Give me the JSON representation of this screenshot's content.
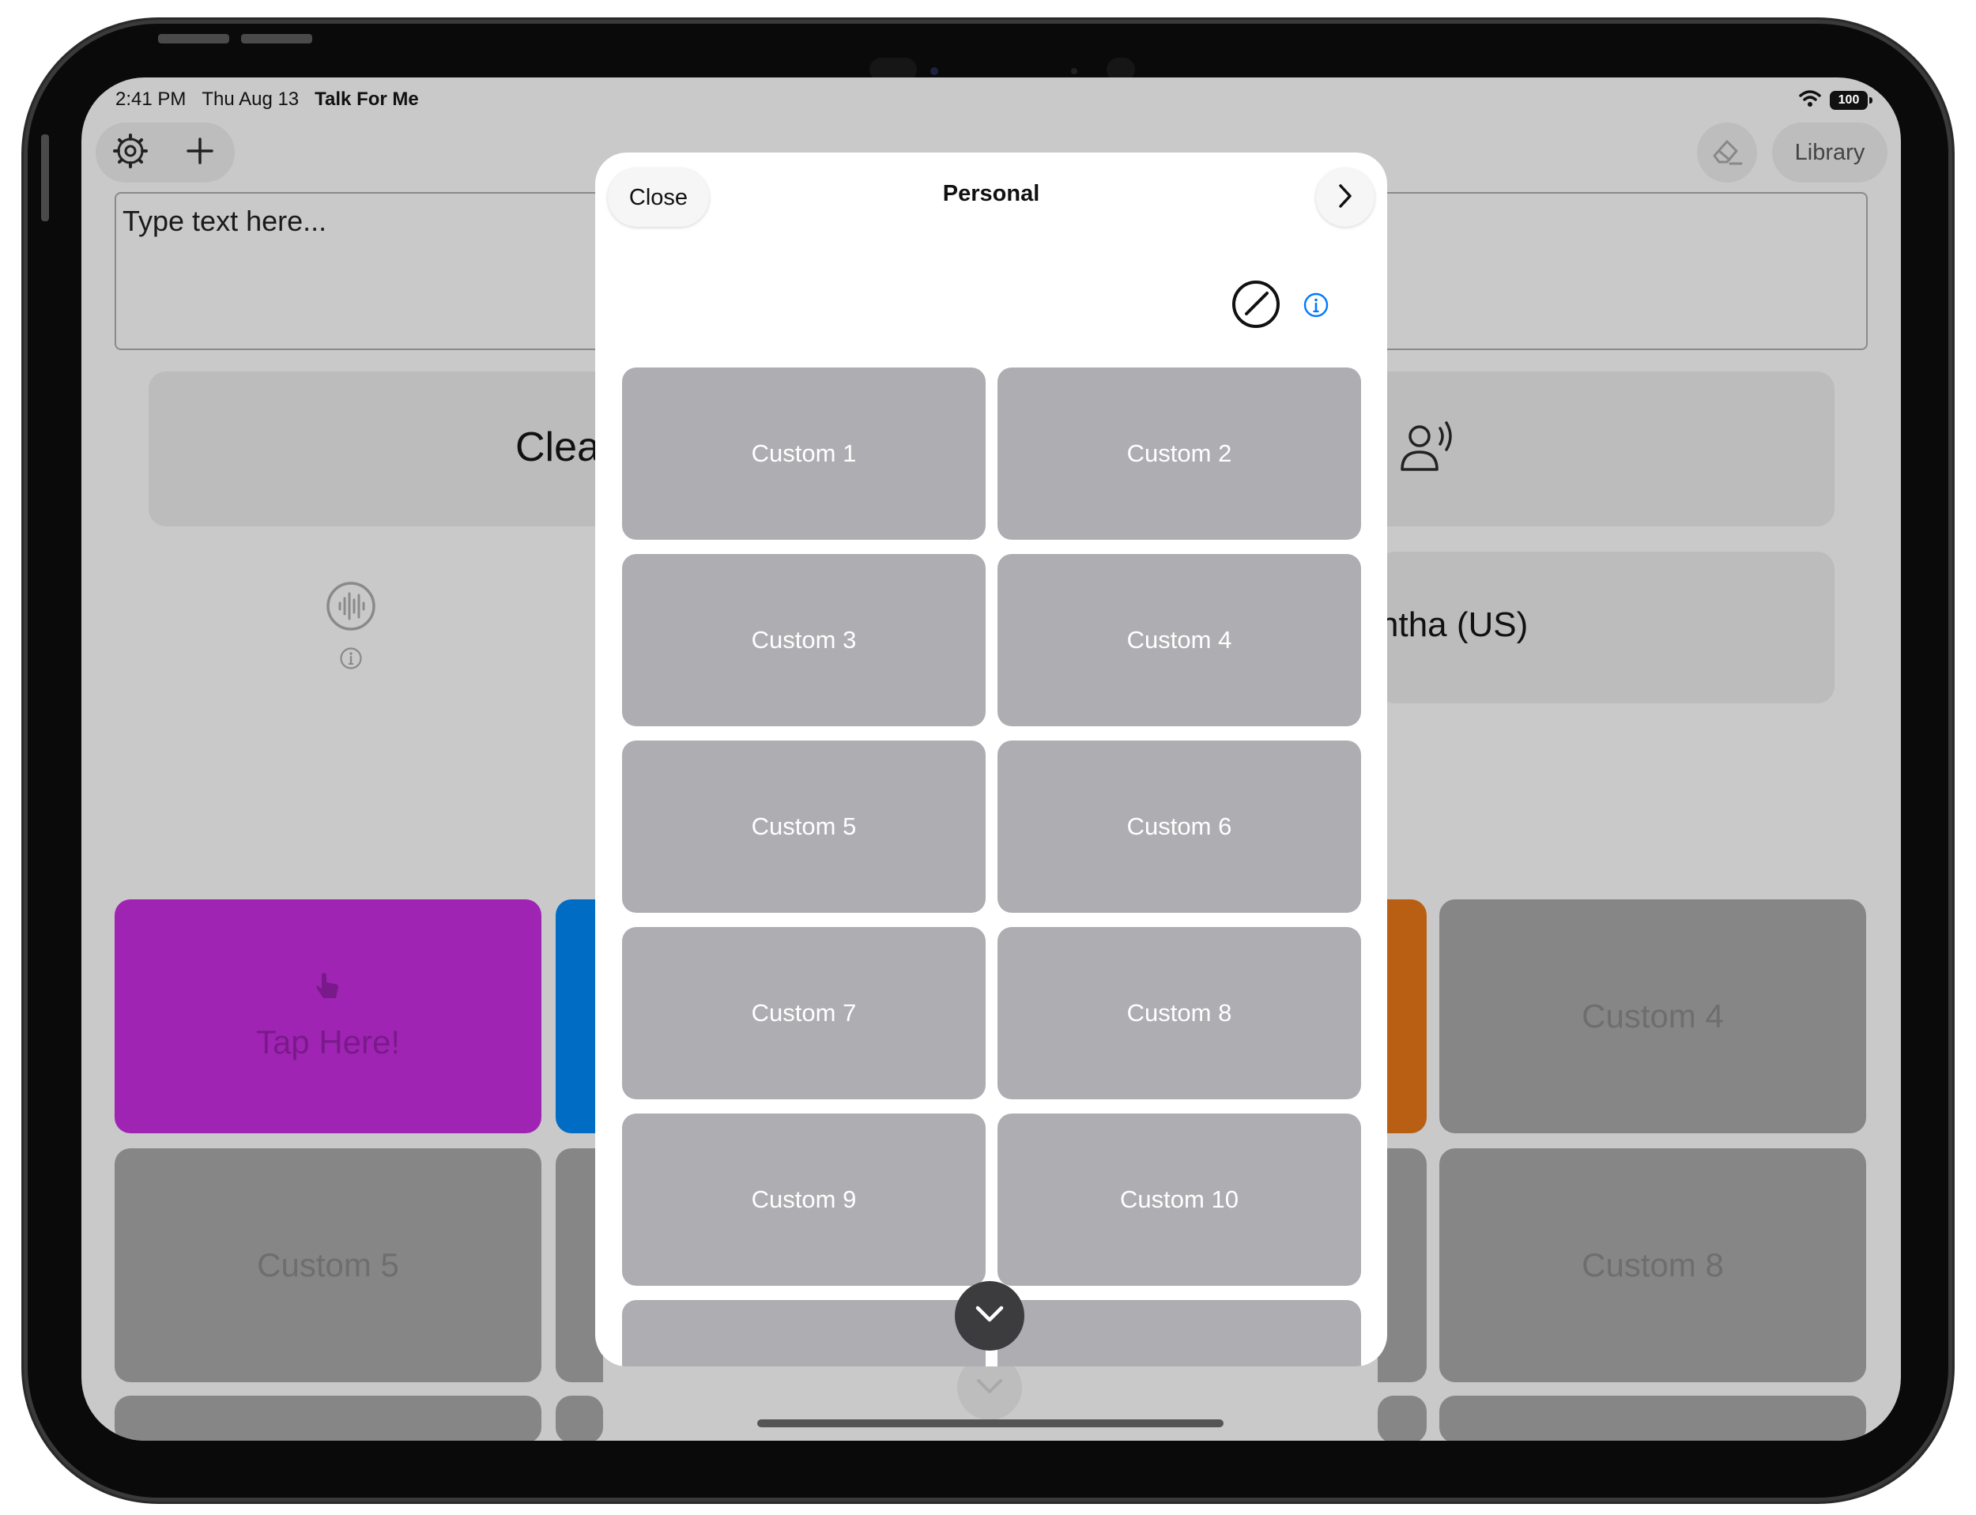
{
  "status_bar": {
    "time": "2:41 PM",
    "date": "Thu Aug 13",
    "app_name": "Talk For Me",
    "battery": "100"
  },
  "toolbar": {
    "library_label": "Library"
  },
  "text_input": {
    "placeholder": "Type text here..."
  },
  "background": {
    "clear_label": "Clea",
    "voice_label": "ntha (US)",
    "tiles": [
      {
        "label": "Tap Here!",
        "color": "#a024b4"
      },
      {
        "label": "",
        "color": "#006cc4"
      },
      {
        "label": "",
        "color": "#b95f14"
      },
      {
        "label": "Custom 4",
        "color": "#868686"
      },
      {
        "label": "Custom 5",
        "color": "#868686"
      },
      {
        "label": "Custom 8",
        "color": "#868686"
      }
    ]
  },
  "modal": {
    "close_label": "Close",
    "title": "Personal",
    "tiles": [
      "Custom 1",
      "Custom 2",
      "Custom 3",
      "Custom 4",
      "Custom 5",
      "Custom 6",
      "Custom 7",
      "Custom 8",
      "Custom 9",
      "Custom 10"
    ]
  },
  "colors": {
    "accent": "#007aff",
    "tile_gray": "#aeaeb2",
    "dim_gray": "#868686"
  },
  "icons": {
    "settings": "gear-icon",
    "add": "plus-icon",
    "eraser": "eraser-icon",
    "speaker": "person-speaking-icon",
    "waveform": "waveform-icon",
    "info": "info-icon",
    "edit": "pencil-circle-icon",
    "next": "chevron-right-icon",
    "scroll": "chevron-down-icon"
  }
}
